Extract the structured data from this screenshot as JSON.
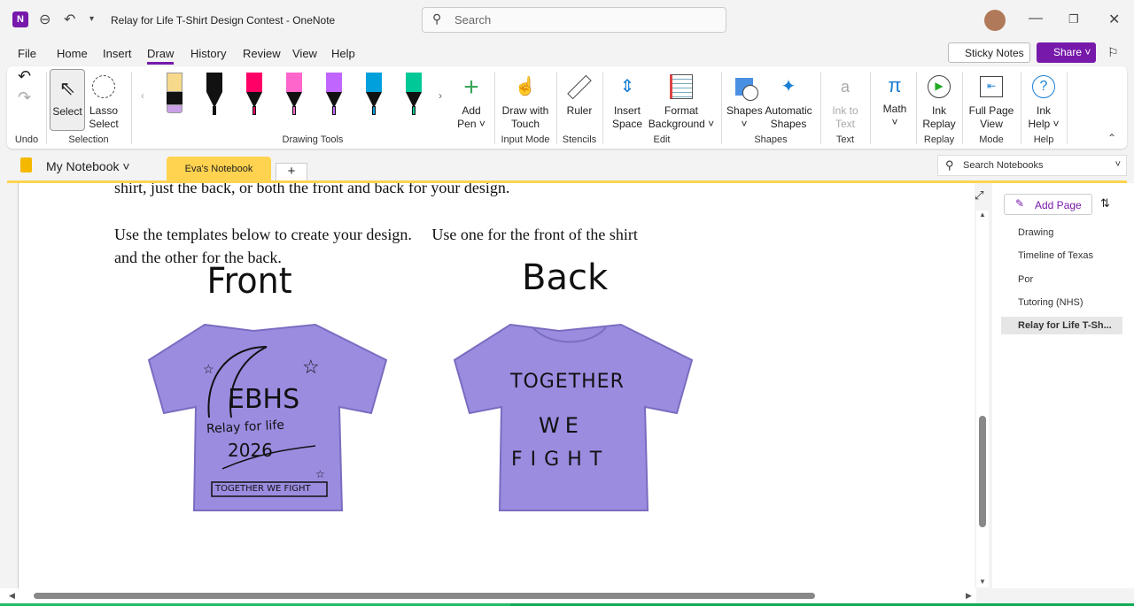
{
  "titlebar": {
    "title": "Relay for Life T-Shirt Design Contest  -  OneNote",
    "search_placeholder": "Search"
  },
  "menu": [
    "File",
    "Home",
    "Insert",
    "Draw",
    "History",
    "Review",
    "View",
    "Help"
  ],
  "menu_active": "Draw",
  "top_right": {
    "sticky_notes": "Sticky Notes",
    "share": "Share"
  },
  "ribbon": {
    "undo_group": "Undo",
    "select": "Select",
    "lasso1": "Lasso",
    "lasso2": "Select",
    "selection_group": "Selection",
    "drawing_tools_group": "Drawing Tools",
    "add_pen1": "Add",
    "add_pen2": "Pen ˅",
    "draw_touch1": "Draw with",
    "draw_touch2": "Touch",
    "input_mode_group": "Input Mode",
    "ruler": "Ruler",
    "stencils_group": "Stencils",
    "insert_space1": "Insert",
    "insert_space2": "Space",
    "format_bg1": "Format",
    "format_bg2": "Background ˅",
    "edit_group": "Edit",
    "shapes": "Shapes",
    "shapes2": "˅",
    "auto_shapes1": "Automatic",
    "auto_shapes2": "Shapes",
    "shapes_group": "Shapes",
    "ink_text1": "Ink to",
    "ink_text2": "Text",
    "text_group": "Text",
    "math": "Math",
    "math2": "˅",
    "ink_replay1": "Ink",
    "ink_replay2": "Replay",
    "replay_group": "Replay",
    "full_page1": "Full Page",
    "full_page2": "View",
    "mode_group": "Mode",
    "ink_help1": "Ink",
    "ink_help2": "Help ˅",
    "help_group": "Help",
    "pen_colors": [
      "#f7d98b",
      "#111111",
      "#ff0066",
      "#ff66cc",
      "#c066ff",
      "#00a0dd",
      "#00c896"
    ]
  },
  "notebook": {
    "name": "My Notebook",
    "section": "Eva's Notebook",
    "add_section": "+",
    "search_placeholder": "Search Notebooks",
    "section_color": "#ffd34f"
  },
  "pages_panel": {
    "add_page": "Add Page",
    "pages": [
      "Drawing",
      "Timeline of Texas",
      "Por",
      "Tutoring (NHS)",
      "Relay for Life T-Sh..."
    ],
    "selected": 4
  },
  "content": {
    "line1": "shirt, just the back, or both the front and back for your design.",
    "line2": "Use the templates below to create your design.     Use one for the front of the shirt",
    "line3": "and the other for the back.",
    "front_label": "Front",
    "back_label": "Back",
    "front_text": {
      "a": "EBHS",
      "b": "Relay for life",
      "c": "2026",
      "d": "TOGETHER WE FIGHT"
    },
    "back_text": {
      "a": "TOGETHER",
      "b": "WE",
      "c": "FIGHT"
    },
    "shirt_color": "#9b8ce0"
  }
}
